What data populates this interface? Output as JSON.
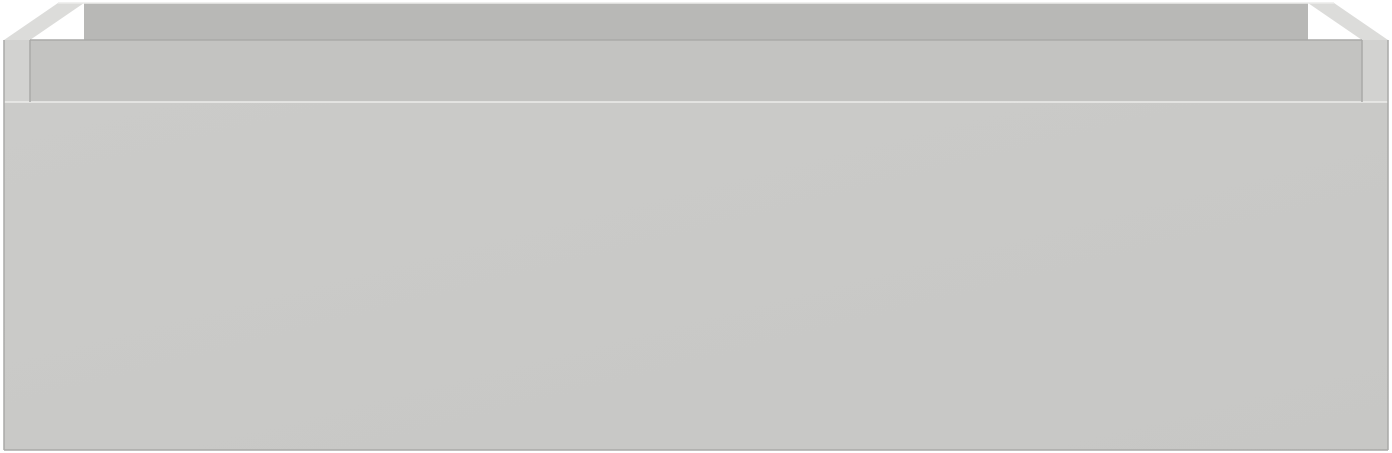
{
  "object": {
    "kind": "drawer-unit-render",
    "colors": {
      "background": "#ffffff",
      "front_panel": "#cbcbc9",
      "front_panel_shade": "#c7c7c5",
      "inner_back_wall": "#b8b8b6",
      "inner_floor_strip": "#c3c3c1",
      "side_wall_top": "#dcdcda",
      "side_wall_face": "#d2d2d0",
      "top_rim": "#e6e6e4",
      "edge_line": "#a9a9a7",
      "highlight": "#ececea"
    }
  }
}
